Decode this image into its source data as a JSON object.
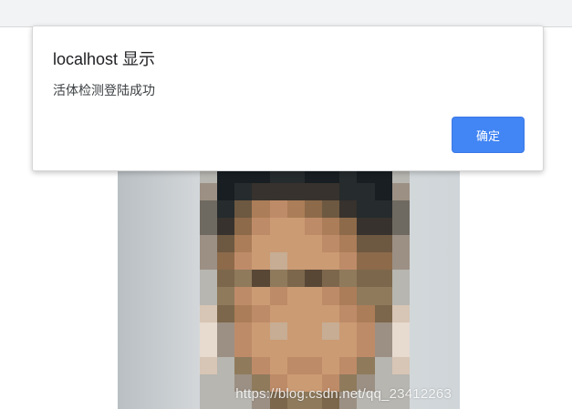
{
  "dialog": {
    "title": "localhost 显示",
    "message": "活体检测登陆成功",
    "ok_label": "确定"
  },
  "watermark": {
    "text": "https://blog.csdn.net/qq_23412263"
  },
  "colors": {
    "button_blue": "#4285f4"
  }
}
